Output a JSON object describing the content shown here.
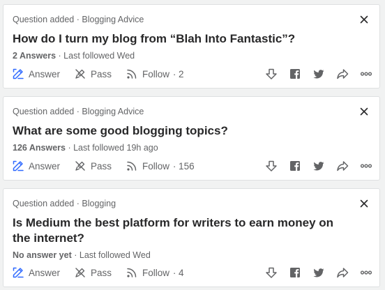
{
  "colors": {
    "accent": "#2e69ff",
    "text": "#282829",
    "muted": "#636466",
    "background": "#f1f2f2"
  },
  "cards": [
    {
      "meta": "Question added · Blogging Advice",
      "title": "How do I turn my blog from “Blah Into Fantastic”?",
      "answers_count": "2 Answers",
      "followed": " · Last followed Wed",
      "answer_label": "Answer",
      "pass_label": "Pass",
      "follow_label": "Follow",
      "follow_count": "· 2"
    },
    {
      "meta": "Question added · Blogging Advice",
      "title": "What are some good blogging topics?",
      "answers_count": "126 Answers",
      "followed": " · Last followed 19h ago",
      "answer_label": "Answer",
      "pass_label": "Pass",
      "follow_label": "Follow",
      "follow_count": "· 156"
    },
    {
      "meta": "Question added · Blogging",
      "title": "Is Medium the best platform for writers to earn money on the internet?",
      "answers_count": "No answer yet",
      "followed": " · Last followed Wed",
      "answer_label": "Answer",
      "pass_label": "Pass",
      "follow_label": "Follow",
      "follow_count": "· 4"
    }
  ],
  "icons": [
    "close-icon",
    "answer-pencil-icon",
    "pass-icon",
    "follow-rss-icon",
    "downvote-icon",
    "facebook-icon",
    "twitter-icon",
    "share-icon",
    "more-icon"
  ]
}
